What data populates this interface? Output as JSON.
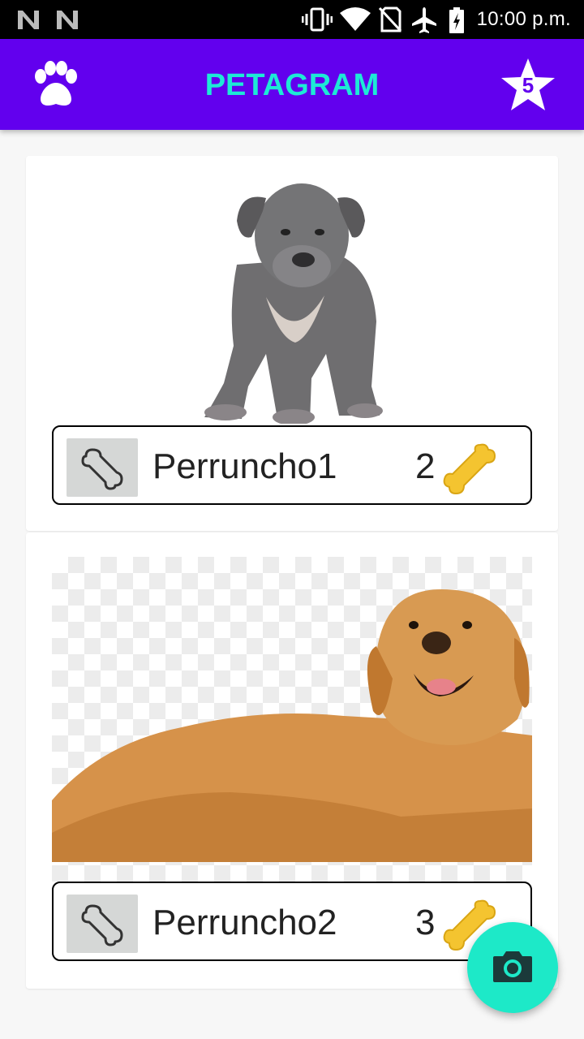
{
  "status_bar": {
    "time": "10:00 p.m.",
    "icons": [
      "n-notification-icon",
      "n-notification-icon",
      "vibrate-icon",
      "wifi-icon",
      "no-sim-icon",
      "airplane-icon",
      "battery-icon"
    ]
  },
  "app_bar": {
    "title": "PETAGRAM",
    "star_count": "5",
    "left_icon": "paw-icon",
    "right_icon": "star-icon"
  },
  "pets": [
    {
      "name": "Perruncho1",
      "likes": "2",
      "image": "gray-puppy-photo"
    },
    {
      "name": "Perruncho2",
      "likes": "3",
      "image": "golden-retriever-photo"
    }
  ],
  "fab": {
    "icon": "camera-icon"
  },
  "colors": {
    "primary": "#6200ee",
    "accent": "#1de9d6",
    "fab": "#1de9c8",
    "bone_gold": "#f4c430"
  }
}
